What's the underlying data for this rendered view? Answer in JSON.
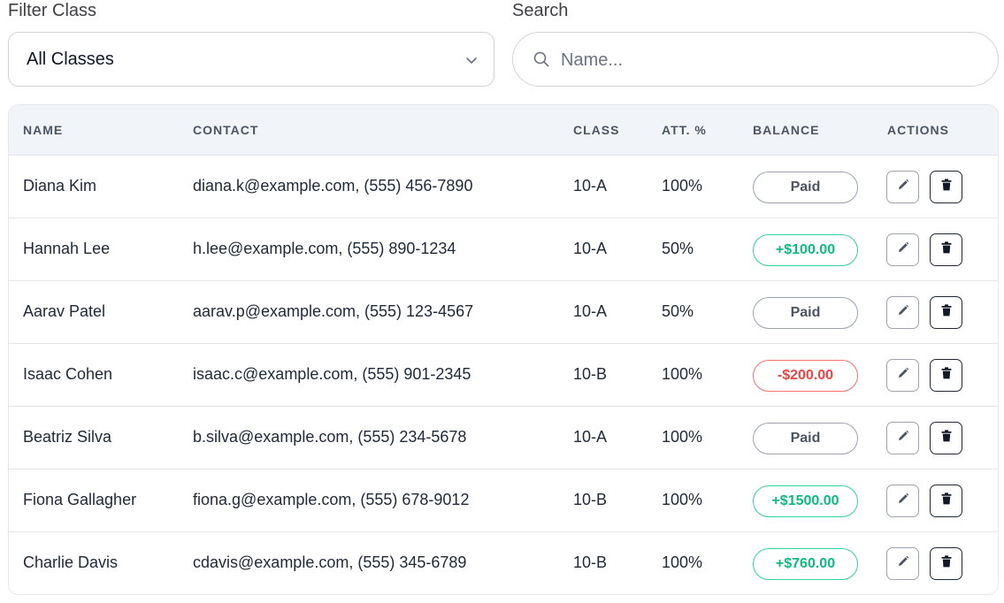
{
  "filters": {
    "class_label": "Filter Class",
    "class_value": "All Classes",
    "search_label": "Search",
    "search_placeholder": "Name...",
    "search_value": ""
  },
  "table": {
    "headers": {
      "name": "NAME",
      "contact": "CONTACT",
      "class": "CLASS",
      "att": "ATT. %",
      "balance": "BALANCE",
      "actions": "ACTIONS"
    },
    "rows": [
      {
        "name": "Diana Kim",
        "contact": "diana.k@example.com, (555) 456-7890",
        "class": "10-A",
        "att": "100%",
        "balance": "Paid",
        "status": "paid"
      },
      {
        "name": "Hannah Lee",
        "contact": "h.lee@example.com, (555) 890-1234",
        "class": "10-A",
        "att": "50%",
        "balance": "+$100.00",
        "status": "credit"
      },
      {
        "name": "Aarav Patel",
        "contact": "aarav.p@example.com, (555) 123-4567",
        "class": "10-A",
        "att": "50%",
        "balance": "Paid",
        "status": "paid"
      },
      {
        "name": "Isaac Cohen",
        "contact": "isaac.c@example.com, (555) 901-2345",
        "class": "10-B",
        "att": "100%",
        "balance": "-$200.00",
        "status": "due"
      },
      {
        "name": "Beatriz Silva",
        "contact": "b.silva@example.com, (555) 234-5678",
        "class": "10-A",
        "att": "100%",
        "balance": "Paid",
        "status": "paid"
      },
      {
        "name": "Fiona Gallagher",
        "contact": "fiona.g@example.com, (555) 678-9012",
        "class": "10-B",
        "att": "100%",
        "balance": "+$1500.00",
        "status": "credit"
      },
      {
        "name": "Charlie Davis",
        "contact": "cdavis@example.com, (555) 345-6789",
        "class": "10-B",
        "att": "100%",
        "balance": "+$760.00",
        "status": "credit"
      }
    ],
    "row_icons": {
      "edit": "pencil-icon",
      "delete": "trash-icon"
    }
  },
  "colors": {
    "positive": "#10b981",
    "negative": "#ef4444",
    "neutral": "#4b5563",
    "header_bg": "#f1f5f9"
  }
}
